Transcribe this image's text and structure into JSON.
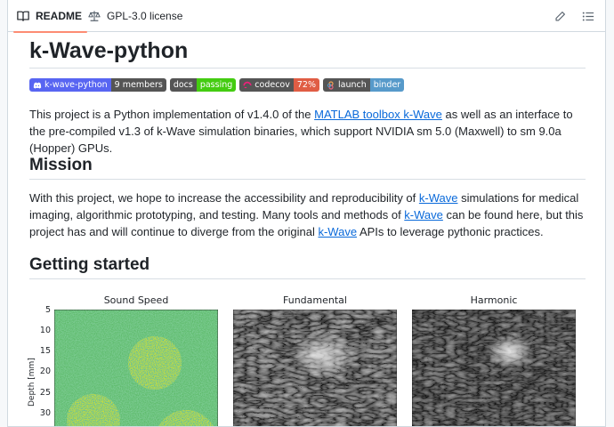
{
  "tabs": {
    "readme": "README",
    "license": "GPL-3.0 license"
  },
  "title": "k-Wave-python",
  "badges": {
    "discord": {
      "left": "k-wave-python",
      "right": "9 members"
    },
    "docs": {
      "left": "docs",
      "right": "passing"
    },
    "codecov": {
      "left": "codecov",
      "right": "72%"
    },
    "binder": {
      "left": "launch",
      "right": "binder"
    }
  },
  "intro": {
    "before": "This project is a Python implementation of v1.4.0 of the ",
    "link": "MATLAB toolbox k-Wave",
    "after": " as well as an interface to the pre-compiled v1.3 of k-Wave simulation binaries, which support NVIDIA sm 5.0 (Maxwell) to sm 9.0a (Hopper) GPUs."
  },
  "mission": {
    "heading": "Mission",
    "p1": "With this project, we hope to increase the accessibility and reproducibility of ",
    "link1": "k-Wave",
    "p2": " simulations for medical imaging, algorithmic prototyping, and testing. Many tools and methods of ",
    "link2": "k-Wave",
    "p3": " can be found here, but this project has and will continue to diverge from the original ",
    "link3": "k-Wave",
    "p4": " APIs to leverage pythonic practices."
  },
  "getting_started": {
    "heading": "Getting started"
  },
  "figure": {
    "panels": [
      "Sound Speed",
      "Fundamental",
      "Harmonic"
    ],
    "ylabel": "Depth [mm]",
    "yticks": [
      "5",
      "10",
      "15",
      "20",
      "25",
      "30"
    ]
  }
}
